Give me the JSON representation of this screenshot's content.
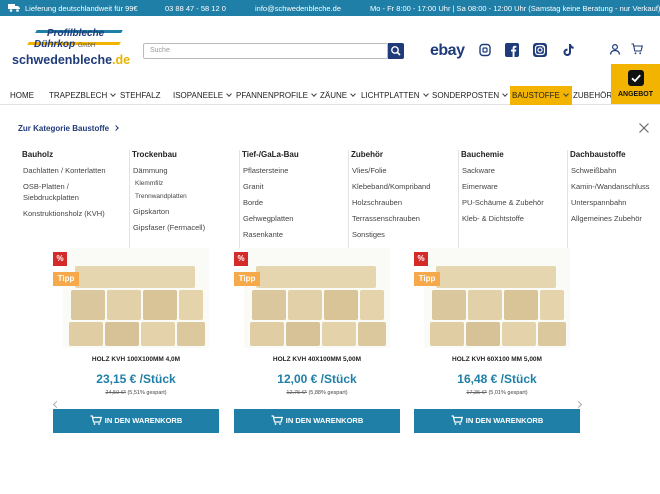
{
  "topbar": {
    "shipping": "Lieferung deutschlandweit für 99€",
    "phone": "03 88 47 - 58 12 0",
    "email": "info@schwedenbleche.de",
    "hours": "Mo - Fr 8:00 - 17:00 Uhr | Sa 08:00 - 12:00 Uhr (Samstag keine Beratung - nur Verkauf)"
  },
  "logo": {
    "line1": "Profilbleche",
    "line2": "Dührkop",
    "line2_suffix": "GmbH",
    "brand_main": "schwedenbleche",
    "brand_tld": ".de"
  },
  "search": {
    "placeholder": "Suche"
  },
  "header": {
    "ebay": "ebay",
    "icons": [
      "scale-icon",
      "facebook-icon",
      "instagram-icon",
      "tiktok-icon",
      "user-icon",
      "cart-icon"
    ]
  },
  "angebot": {
    "label": "ANGEBOT"
  },
  "nav": {
    "items": [
      "HOME",
      "TRAPEZBLECH",
      "STEHFALZ",
      "ISOPANEELE",
      "PFANNENPROFILE",
      "ZÄUNE",
      "LICHTPLATTEN",
      "SONDERPOSTEN",
      "BAUSTOFFE",
      "ZUBEHÖR"
    ],
    "active": "BAUSTOFFE"
  },
  "megamenu": {
    "category_link": "Zur Kategorie Baustoffe",
    "columns": [
      {
        "heading": "Bauholz",
        "links": [
          "Dachlatten / Konterlatten",
          "OSB-Platten / Siebdruckplatten",
          "Konstruktionsholz (KVH)"
        ]
      },
      {
        "heading": "Trockenbau",
        "links": [
          "Dämmung",
          "Klemmfilz",
          "Trennwandplatten",
          "Gipskarton",
          "Gipsfaser (Fermacell)"
        ]
      },
      {
        "heading": "Tief-/GaLa-Bau",
        "links": [
          "Pflastersteine",
          "Granit",
          "Borde",
          "Gehwegplatten",
          "Rasenkante"
        ]
      },
      {
        "heading": "Zubehör",
        "links": [
          "Vlies/Folie",
          "Klebeband/Kompriband",
          "Holzschrauben",
          "Terrassenschrauben",
          "Sonstiges"
        ]
      },
      {
        "heading": "Bauchemie",
        "links": [
          "Sackware",
          "Eimerware",
          "PU-Schäume & Zubehör",
          "Kleb- & Dichtstoffe"
        ]
      },
      {
        "heading": "Dachbaustoffe",
        "links": [
          "Schweißbahn",
          "Kamin-/Wandanschluss",
          "Unterspannbahn",
          "Allgemeines Zubehör"
        ]
      }
    ]
  },
  "products": [
    {
      "badge_pct": "%",
      "badge_tipp": "Tipp",
      "name": "HOLZ KVH 100X100MM 4,0M",
      "price": "23,15 € /Stück",
      "old_price": "24,50 €*",
      "saving": "(5,51% gespart)",
      "cart_label": "IN DEN WARENKORB"
    },
    {
      "badge_pct": "%",
      "badge_tipp": "Tipp",
      "name": "HOLZ KVH 40X100MM 5,00M",
      "price": "12,00 € /Stück",
      "old_price": "12,75 €*",
      "saving": "(5,88% gespart)",
      "cart_label": "IN DEN WARENKORB"
    },
    {
      "badge_pct": "%",
      "badge_tipp": "Tipp",
      "name": "HOLZ KVH 60X100 MM 5,00M",
      "price": "16,48 € /Stück",
      "old_price": "17,35 €*",
      "saving": "(5,01% gespart)",
      "cart_label": "IN DEN WARENKORB"
    }
  ],
  "colors": {
    "primary": "#1f7fa6",
    "brand_dark": "#1f3b7a",
    "accent": "#f2b400",
    "sale": "#d42a2a",
    "tipp": "#f6a94a"
  }
}
